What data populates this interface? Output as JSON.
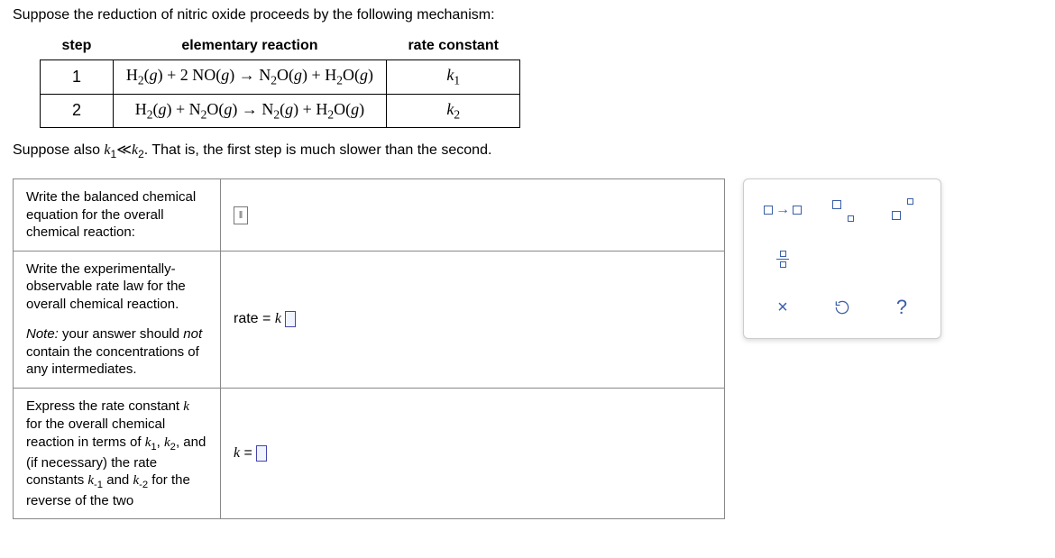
{
  "intro": "Suppose the reduction of nitric oxide proceeds by the following mechanism:",
  "table": {
    "headers": {
      "step": "step",
      "reaction": "elementary reaction",
      "rate": "rate constant"
    },
    "rows": [
      {
        "step": "1",
        "reaction_html": "H<sub>2</sub>(<span class='ital'>g</span>) + 2 NO(<span class='ital'>g</span>) → N<sub>2</sub>O(<span class='ital'>g</span>) + H<sub>2</sub>O(<span class='ital'>g</span>)",
        "rate_html": "<span class='kk'>k</span><sub>1</sub>"
      },
      {
        "step": "2",
        "reaction_html": "H<sub>2</sub>(<span class='ital'>g</span>) + N<sub>2</sub>O(<span class='ital'>g</span>) → N<sub>2</sub>(<span class='ital'>g</span>) + H<sub>2</sub>O(<span class='ital'>g</span>)",
        "rate_html": "<span class='kk'>k</span><sub>2</sub>"
      }
    ]
  },
  "assume_html": "Suppose also <span class='kk'>k</span><sub>1</sub><span class='not-ital'>≪</span><span class='kk'>k</span><sub>2</sub>. That is, the first step is much slower than the second.",
  "questions": {
    "q1_label": "Write the balanced chemical equation for the overall chemical reaction:",
    "q2_label": "Write the experimentally-observable rate law for the overall chemical reaction.",
    "q2_note_html": "<i>Note:</i> your answer should <i>not</i> contain the concentrations of any intermediates.",
    "q2_prefix_html": "rate = <span class='kk'>k</span>",
    "q3_label_html": "Express the rate constant <span class='kk'>k</span> for the overall chemical reaction in terms of <span class='kk'>k</span><sub>1</sub>, <span class='kk'>k</span><sub>2</sub>, and (if necessary) the rate constants <span class='kk'>k</span><sub>-1</sub> and <span class='kk'>k</span><sub>-2</sub> for the reverse of the two",
    "q3_prefix_html": "<span class='kk'>k</span> ="
  },
  "palette": {
    "clear": "×",
    "help": "?"
  }
}
